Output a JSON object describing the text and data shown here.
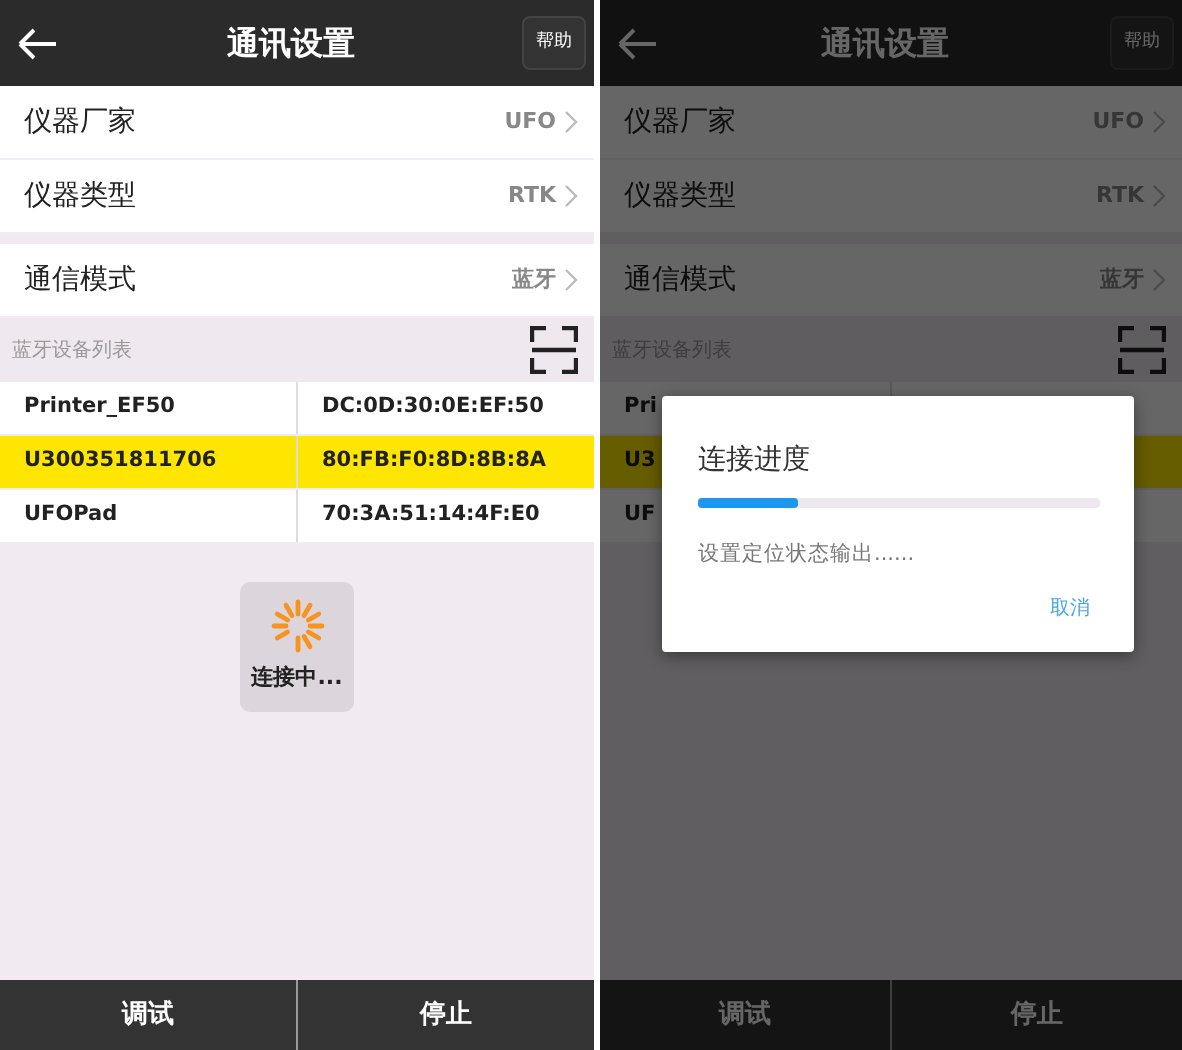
{
  "screens": [
    {
      "kind": "loading",
      "header": {
        "title": "通讯设置",
        "help": "帮助"
      },
      "setting_groups": [
        [
          {
            "label": "仪器厂家",
            "value": "UFO"
          },
          {
            "label": "仪器类型",
            "value": "RTK"
          }
        ],
        [
          {
            "label": "通信模式",
            "value": "蓝牙"
          }
        ]
      ],
      "section_title": "蓝牙设备列表",
      "devices": [
        {
          "name": "Printer_EF50",
          "mac": "DC:0D:30:0E:EF:50",
          "selected": false
        },
        {
          "name": "U300351811706",
          "mac": "80:FB:F0:8D:8B:8A",
          "selected": true
        },
        {
          "name": "UFOPad",
          "mac": "70:3A:51:14:4F:E0",
          "selected": false
        }
      ],
      "toast": {
        "text": "连接中..."
      },
      "buttons": [
        "调试",
        "停止"
      ]
    },
    {
      "kind": "dialog",
      "header": {
        "title": "通讯设置",
        "help": "帮助"
      },
      "setting_groups": [
        [
          {
            "label": "仪器厂家",
            "value": "UFO"
          },
          {
            "label": "仪器类型",
            "value": "RTK"
          }
        ],
        [
          {
            "label": "通信模式",
            "value": "蓝牙"
          }
        ]
      ],
      "section_title": "蓝牙设备列表",
      "devices": [
        {
          "name": "Pri",
          "selected": false
        },
        {
          "name": "U3",
          "selected": true
        },
        {
          "name": "UF",
          "selected": false
        }
      ],
      "dialog": {
        "title": "连接进度",
        "level": 0.25,
        "message": "设置定位状态输出......",
        "cancel": "取消"
      },
      "buttons": [
        "调试",
        "停止"
      ]
    }
  ]
}
